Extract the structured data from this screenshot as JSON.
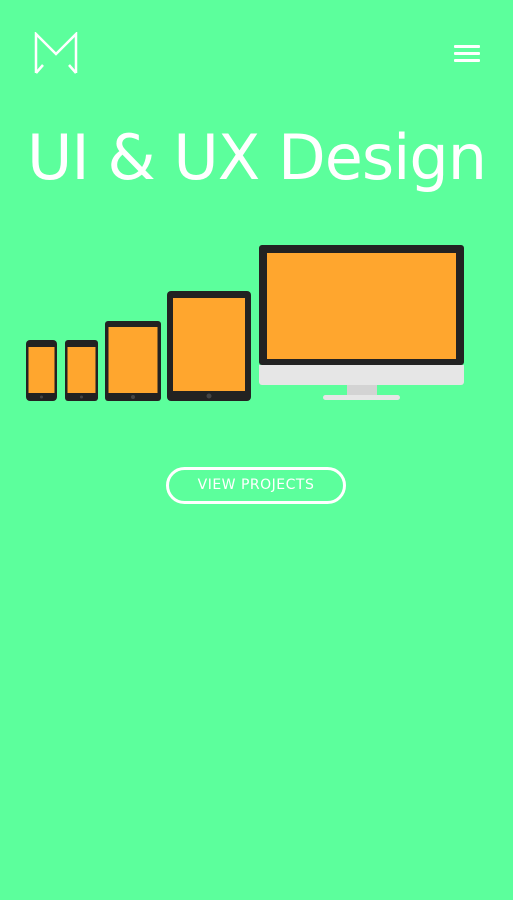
{
  "header": {
    "logo_icon": "m-monogram-logo-icon",
    "menu_icon": "hamburger-menu-icon"
  },
  "hero": {
    "title": "UI & UX Design",
    "cta_label": "VIEW PROJECTS"
  },
  "illustration": {
    "devices": [
      "phone",
      "phone",
      "tablet-small",
      "tablet",
      "desktop-monitor"
    ]
  },
  "colors": {
    "background": "#5CFF9C",
    "text": "#FFFFFF",
    "device_frame": "#222222",
    "device_screen": "#FFA62E",
    "monitor_chin": "#E6E6E6",
    "monitor_stand": "#D3D3D3"
  }
}
